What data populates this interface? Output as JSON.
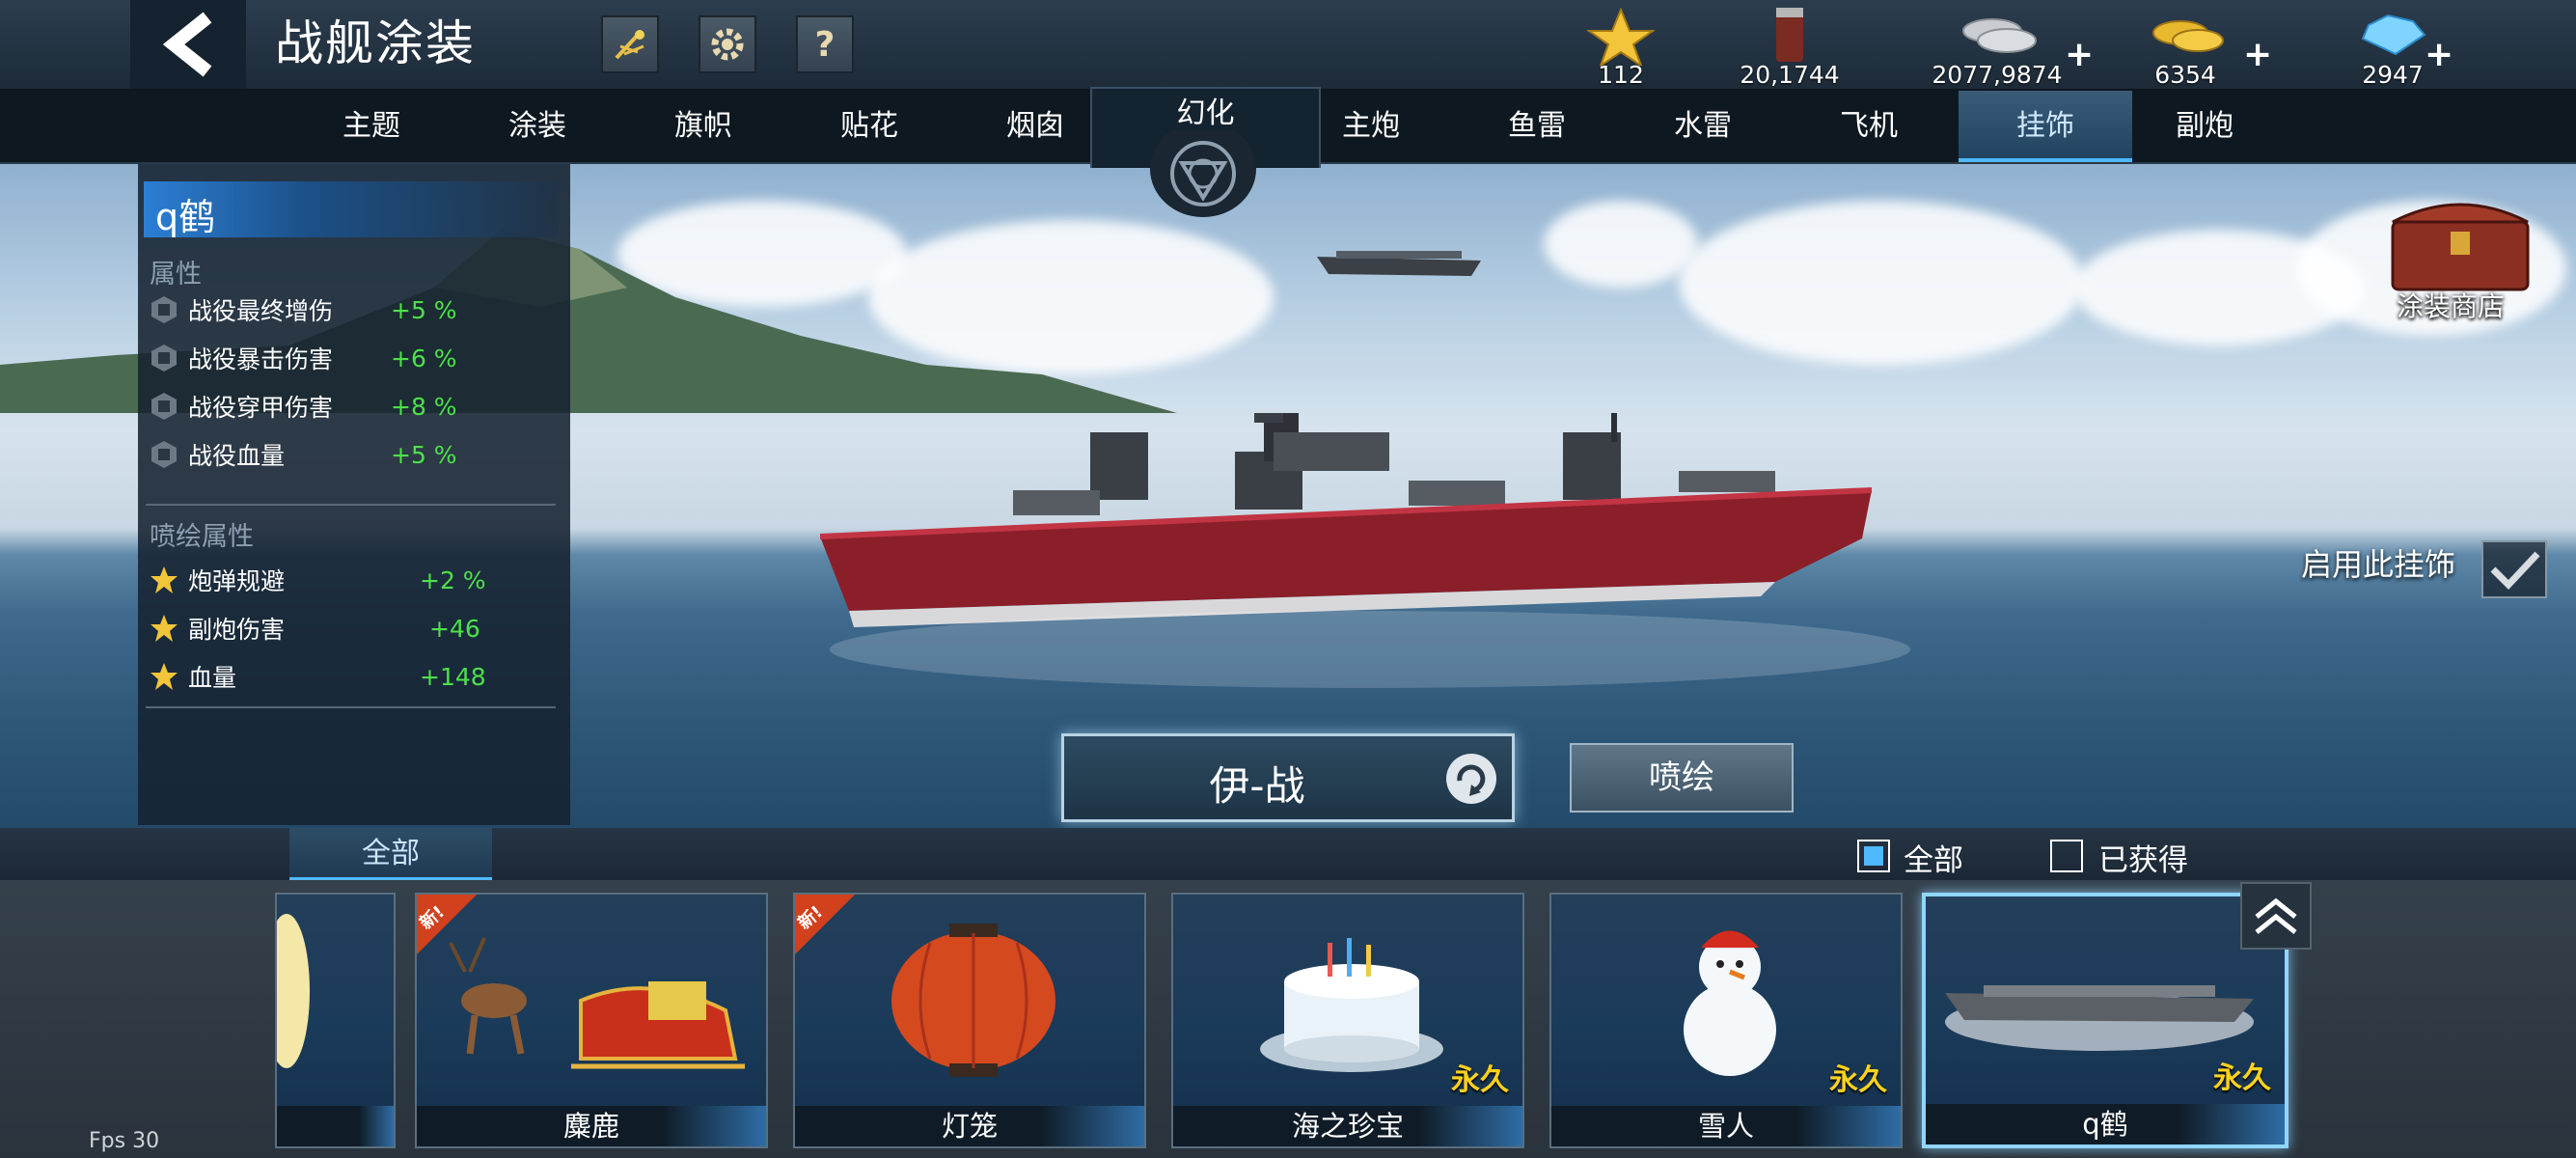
{
  "header": {
    "title": "战舰涂装",
    "resources": [
      {
        "name": "star",
        "value": "112"
      },
      {
        "name": "paint-bucket",
        "value": "20,1744"
      },
      {
        "name": "silver-coins",
        "value": "2077,9874"
      },
      {
        "name": "gold-coins",
        "value": "6354"
      },
      {
        "name": "diamonds",
        "value": "2947"
      }
    ]
  },
  "tabs": [
    "主题",
    "涂装",
    "旗帜",
    "贴花",
    "烟囱",
    "幻化",
    "主炮",
    "鱼雷",
    "水雷",
    "飞机",
    "挂饰",
    "副炮"
  ],
  "active_tab": "挂饰",
  "panel": {
    "name": "q鹤",
    "section1": "属性",
    "attrs": [
      {
        "label": "战役最终增伤",
        "value": "+5 %"
      },
      {
        "label": "战役暴击伤害",
        "value": "+6 %"
      },
      {
        "label": "战役穿甲伤害",
        "value": "+8 %"
      },
      {
        "label": "战役血量",
        "value": "+5 %"
      }
    ],
    "section2": "喷绘属性",
    "spray_attrs": [
      {
        "label": "炮弹规避",
        "value": "+2 %"
      },
      {
        "label": "副炮伤害",
        "value": "+46"
      },
      {
        "label": "血量",
        "value": "+148"
      }
    ]
  },
  "shop_label": "涂装商店",
  "enable_label": "启用此挂饰",
  "ship_name": "伊-战",
  "spray_button": "喷绘",
  "filter": {
    "tab": "全部",
    "all_label": "全部",
    "owned_label": "已获得"
  },
  "items": [
    {
      "name": "",
      "new": false,
      "permanent": ""
    },
    {
      "name": "麋鹿",
      "new": true,
      "new_label": "新!",
      "permanent": ""
    },
    {
      "name": "灯笼",
      "new": true,
      "new_label": "新!",
      "permanent": ""
    },
    {
      "name": "海之珍宝",
      "new": false,
      "permanent": "永久"
    },
    {
      "name": "雪人",
      "new": false,
      "permanent": "永久"
    },
    {
      "name": "q鹤",
      "new": false,
      "permanent": "永久"
    }
  ],
  "fps": "Fps 30",
  "colors": {
    "positive": "#4ee04a",
    "permanent": "#ffd21f",
    "active_tab": "#4fb8ff"
  }
}
